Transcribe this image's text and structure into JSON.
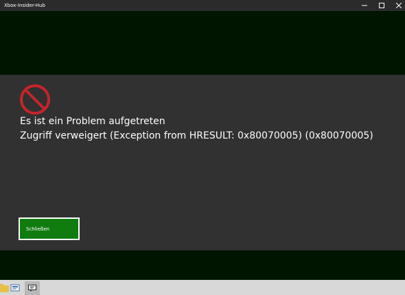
{
  "window": {
    "title": "Xbox-Insider-Hub",
    "controls": [
      "minimize-icon",
      "maximize-icon",
      "close-icon"
    ]
  },
  "dialog": {
    "icon": "no-entry-icon",
    "icon_color": "#c8232c",
    "heading": "Es ist ein Problem aufgetreten",
    "message": "Zugriff verweigert (Exception from HRESULT: 0x80070005) (0x80070005)",
    "close_label": "Schließen",
    "button_color": "#107c10"
  },
  "taskbar": {
    "items": [
      "folder-icon",
      "app-icon",
      "chat-icon"
    ]
  }
}
